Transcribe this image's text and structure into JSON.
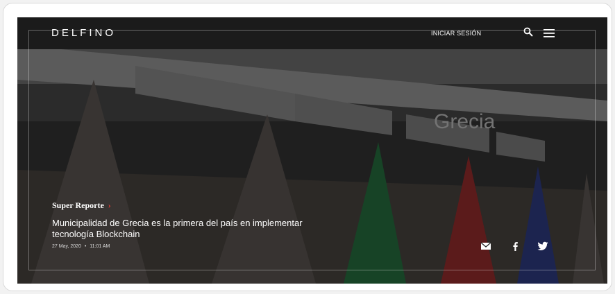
{
  "header": {
    "brand": "DELFINO",
    "login_label": "INICIAR SESIÓN",
    "search_icon": "search-icon",
    "menu_icon": "hamburger-menu-icon"
  },
  "article": {
    "section": "Super Reporte",
    "section_chevron": "›",
    "title": "Municipalidad de Grecia es la primera del país en implementar tecnología Blockchain",
    "date": "27 May, 2020",
    "separator": "•",
    "time": "11:01 AM",
    "photo_sign_text": "Grecia"
  },
  "share": {
    "email_icon": "email-icon",
    "facebook_icon": "facebook-icon",
    "twitter_icon": "twitter-icon"
  },
  "colors": {
    "accent": "#e53935",
    "header_bg": "#1b1b1b",
    "text": "#ffffff"
  }
}
